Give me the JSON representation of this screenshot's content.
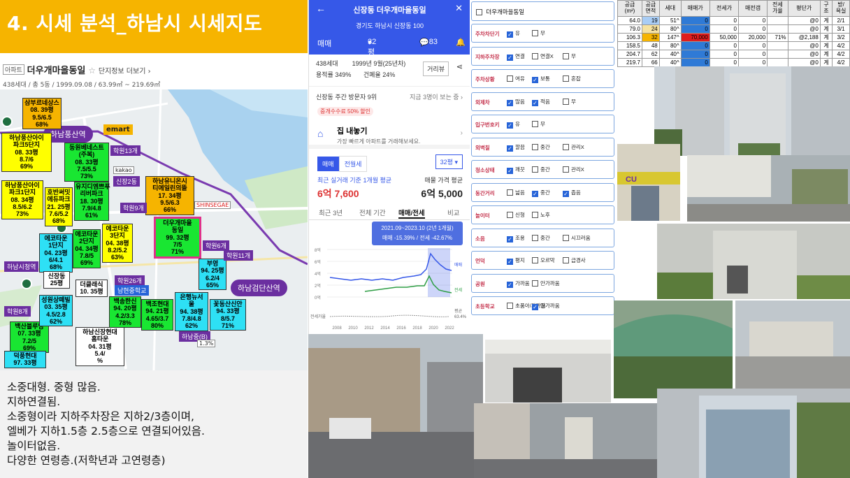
{
  "header": {
    "title": "4. 시세 분석_하남시 시세지도"
  },
  "apt": {
    "tag": "아파트",
    "name": "더우개마을동일",
    "more": "단지정보 더보기",
    "sub": "438세대 / 총 5동 / 1999.09.08 / 63.99㎡ ~ 219.69㎡"
  },
  "map": {
    "stations": {
      "pungsan": "하남풍산역",
      "geomdan": "하남검단산역",
      "sicheong": "하남시청역"
    },
    "emart": "emart",
    "kakao": "kakao",
    "shinsegae": "SHINSEGAE",
    "labels": [
      {
        "t": "삼부르네상스\n08. 39평\n9.5/6.5\n68%"
      },
      {
        "t": "하남풍산아이\n파크5단지\n08. 33평\n8.7/6\n69%"
      },
      {
        "t": "동원베네스트\n(주복)\n08. 33평\n7.5/5.5\n73%"
      },
      {
        "t": "하남풍산아이\n파크1단지\n08. 34평\n8.5/6.2\n73%"
      },
      {
        "t": "호반써밋\n에듀파크\n21. 25평\n7.6/5.2\n68%"
      },
      {
        "t": "유지디엠쁘푸\n리버파크\n18. 30평\n7.9/4.8\n61%"
      },
      {
        "t": "하남유니온시\n티에일린의뜰\n17. 34평\n9.5/6.3\n66%"
      },
      {
        "t": "에코타운\n1단지\n04. 23평\n6/4.1\n68%"
      },
      {
        "t": "에코타운\n2단지\n04. 34평\n7.8/5\n69%"
      },
      {
        "t": "에코타운\n3단지\n04. 38평\n8.2/5.2\n63%"
      },
      {
        "t": "더우개마을\n동일\n99. 32평\n7/5\n71%"
      },
      {
        "t": "백조현대\n94. 21평\n4.65/3.7\n80%"
      },
      {
        "t": "백송한신\n94. 20평\n4.2/3.3\n78%"
      },
      {
        "t": "은행뉴서\n울\n94. 38평\n7.8/4.8\n62%"
      },
      {
        "t": "꽃동산신안\n94. 33평\n8/5.7\n71%"
      },
      {
        "t": "부영\n94. 25평\n6.2/4\n65%"
      },
      {
        "t": "백산블루밍\n07. 33평\n7.2/5\n69%"
      },
      {
        "t": "하남신장현대\n홈타운\n04. 31평\n5.4/\n%"
      },
      {
        "t": "덕풍현대\n97. 33평"
      }
    ],
    "chips": [
      "학원13개",
      "신장2동",
      "학원9개",
      "학원6개",
      "학원11개",
      "학원26개",
      "학원8개",
      "남현중학교",
      "하남중(B)",
      "1.3%",
      "더클래식\n10. 35평",
      "성원상떼빌\n03. 35평\n4.5/2.8\n62%",
      "신장동\n25평"
    ]
  },
  "notes": [
    "소중대형. 중형 많음.",
    "지하연결됨.",
    "소중형이라 지하주차장은 지하2/3층이며,",
    "엘베가 지하1.5층 2.5층으로 연결되어있음.",
    "놀이터없음.",
    "다양한 연령층.(저학년과 고연령층)"
  ],
  "mobile": {
    "title": "신장동 더우개마을동일",
    "address": "경기도 하남시 신장동 100",
    "deal": "매매",
    "size": "32평",
    "comments": "83",
    "info_line1": "438세대",
    "info_line1b": "1999년 9월(25년차)",
    "info_line2": "용적률 349%",
    "info_line2b": "건폐율 24%",
    "street_btn": "거리뷰",
    "visit": "신장동 주간 방문자 9위",
    "visit_right": "지금 3명이 보는 중 ›",
    "badge": "중개수수료 50% 할인",
    "home_title": "집 내놓기",
    "home_sub": "가장 빠르게 아파트를 거래해보세요.",
    "tab_on": "매매",
    "tab_off": "전월세",
    "size_sel": "32평",
    "recent_label": "최근 실거래 기준 1개월 평균",
    "recent_val": "6억 7,600",
    "ask_label": "매물 가격 평균",
    "ask_val": "6억 5,000",
    "ptabs": [
      "최근 3년",
      "전체 기간",
      "매매/전세",
      "비교"
    ],
    "chart_note1": "2021.09~2023.10 (2년 1개월)",
    "chart_note2": "매매 -15.39% / 전세 -42.67%",
    "y_ticks": [
      "8억",
      "6억",
      "4억",
      "2억",
      "0억"
    ],
    "x_ticks": [
      "2008",
      "2010",
      "2012",
      "2014",
      "2016",
      "2018",
      "2020",
      "2022"
    ],
    "legend_sale": "매매",
    "legend_rent": "전세",
    "legend_ratio": "전세가율",
    "ratio_val": "63.4%",
    "ratio_title": "평균"
  },
  "checklist": {
    "title": "더우개마을동일",
    "rows": [
      {
        "lab": "주차차단기",
        "items": [
          [
            "유",
            true
          ],
          [
            "무",
            false
          ]
        ]
      },
      {
        "lab": "지하주차장",
        "items": [
          [
            "연결",
            true
          ],
          [
            "연결X",
            false
          ],
          [
            "무",
            false
          ]
        ]
      },
      {
        "lab": "주차상황",
        "items": [
          [
            "여유",
            false
          ],
          [
            "보통",
            true
          ],
          [
            "혼잡",
            false
          ]
        ]
      },
      {
        "lab": "외제차",
        "items": [
          [
            "많음",
            true
          ],
          [
            "적음",
            true
          ],
          [
            "무",
            false
          ]
        ]
      },
      {
        "lab": "입구번호키",
        "items": [
          [
            "유",
            true
          ],
          [
            "무",
            false
          ]
        ]
      },
      {
        "lab": "외벽칠",
        "items": [
          [
            "깔끔",
            true
          ],
          [
            "중간",
            false
          ],
          [
            "관리X",
            false
          ]
        ]
      },
      {
        "lab": "청소상태",
        "items": [
          [
            "깨끗",
            true
          ],
          [
            "중간",
            false
          ],
          [
            "관리X",
            false
          ]
        ]
      },
      {
        "lab": "동간거리",
        "items": [
          [
            "넓음",
            false
          ],
          [
            "중간",
            true
          ],
          [
            "좁음",
            true
          ]
        ]
      },
      {
        "lab": "놀이터",
        "items": [
          [
            "신형",
            false
          ],
          [
            "노후",
            false
          ]
        ]
      },
      {
        "lab": "소음",
        "items": [
          [
            "조용",
            true
          ],
          [
            "중간",
            false
          ],
          [
            "시끄러움",
            false
          ]
        ]
      },
      {
        "lab": "언덕",
        "items": [
          [
            "평지",
            true
          ],
          [
            "오르막",
            false
          ],
          [
            "급경사",
            false
          ]
        ]
      },
      {
        "lab": "공원",
        "items": [
          [
            "가까움",
            true
          ],
          [
            "안가까움",
            false
          ]
        ]
      },
      {
        "lab": "초등학교",
        "items": [
          [
            "초품아/가까움",
            false
          ],
          [
            "안가까움",
            true
          ]
        ]
      }
    ]
  },
  "table": {
    "headers": [
      "공급\n(m²)",
      "공급\n면적",
      "세대",
      "매매가",
      "전세가",
      "매전갭",
      "전세\n가율",
      "평단가",
      "구\n조",
      "방/\n욕실"
    ],
    "rows": [
      [
        "64.0",
        "19",
        "51^",
        "0",
        "0",
        "0",
        "",
        "@0",
        "계",
        "2/1"
      ],
      [
        "79.0",
        "24",
        "80^",
        "0",
        "0",
        "0",
        "",
        "@0",
        "계",
        "3/1"
      ],
      [
        "106.3",
        "32",
        "147^",
        "70,000",
        "50,000",
        "20,000",
        "71%",
        "@2,188",
        "계",
        "3/2"
      ],
      [
        "158.5",
        "48",
        "80^",
        "0",
        "0",
        "0",
        "",
        "@0",
        "계",
        "4/2"
      ],
      [
        "204.7",
        "62",
        "40^",
        "0",
        "0",
        "0",
        "",
        "@0",
        "계",
        "4/2"
      ],
      [
        "219.7",
        "66",
        "40^",
        "0",
        "0",
        "0",
        "",
        "@0",
        "계",
        "4/2"
      ]
    ]
  },
  "photos": {
    "cu_sign": "CU"
  },
  "colors": {
    "title_bg": "#f6b400",
    "brand_blue": "#3658e8",
    "label_red": "#c4304b",
    "map_yellow": "#ffff00",
    "map_green": "#19e632",
    "map_cyan": "#2ee0f5",
    "map_purple": "#6b2fa0",
    "table_highlight_blue": "#2f7ad6",
    "table_highlight_red": "#e01d1d"
  }
}
